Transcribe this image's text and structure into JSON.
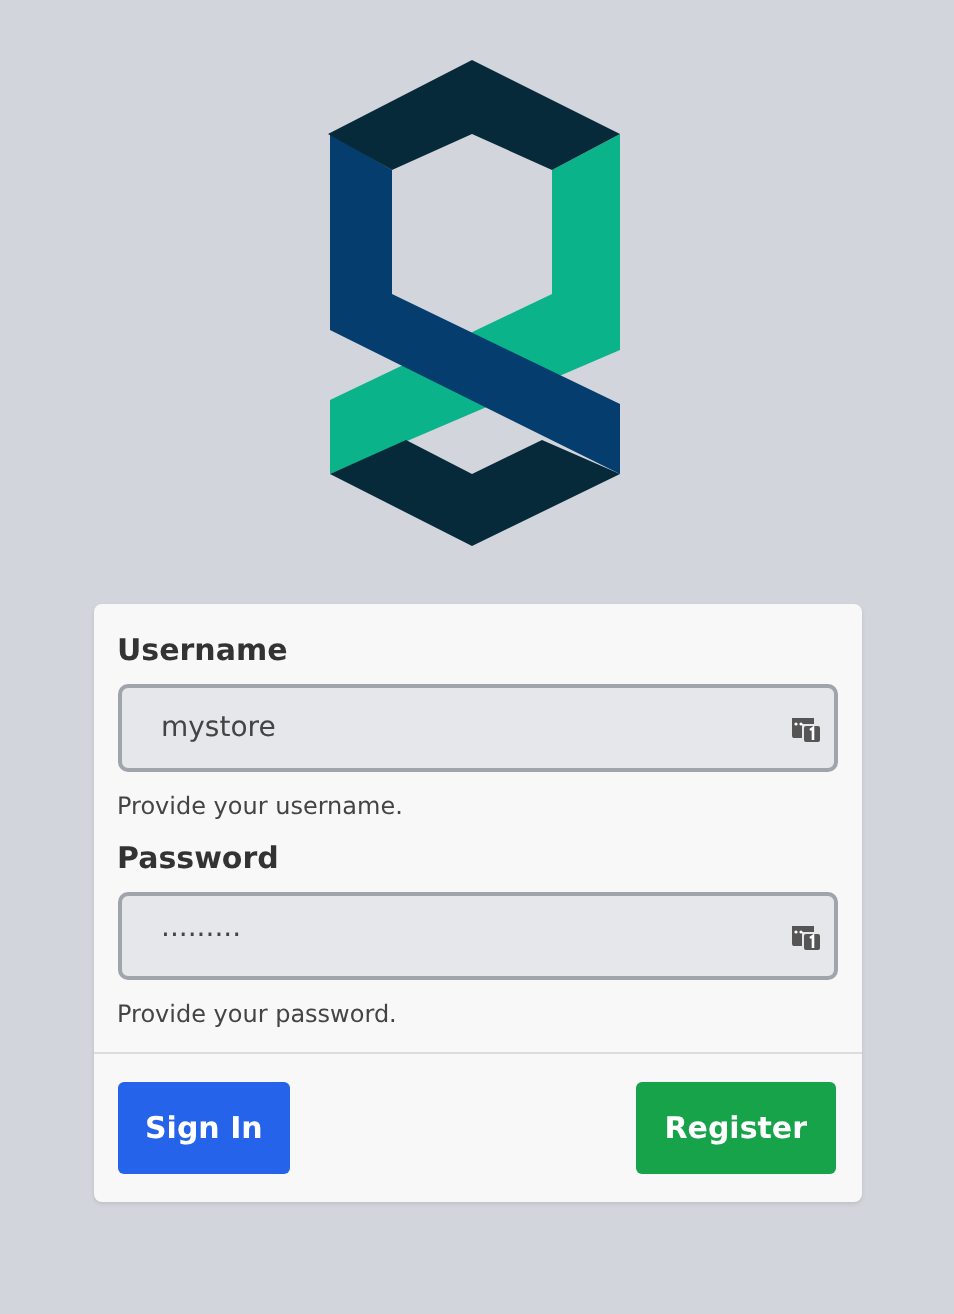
{
  "fields": [
    {
      "label": "Username",
      "value": "mystore",
      "help": "Provide your username."
    },
    {
      "label": "Password",
      "value": "·········",
      "help": "Provide your password."
    }
  ],
  "buttons": [
    {
      "label": "Sign In",
      "kind": "primary"
    },
    {
      "label": "Register",
      "kind": "success"
    }
  ]
}
